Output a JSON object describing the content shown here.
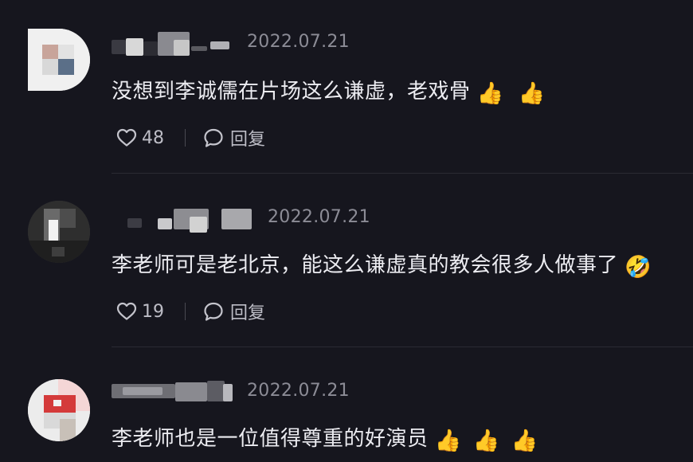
{
  "comments": [
    {
      "date": "2022.07.21",
      "text": "没想到李诚儒在片场这么谦虚，老戏骨",
      "emojis": [
        "👍",
        "👍"
      ],
      "likes": "48",
      "reply_label": "回复"
    },
    {
      "date": "2022.07.21",
      "text": "李老师可是老北京，能这么谦虚真的教会很多人做事了",
      "emojis": [
        "🤣"
      ],
      "likes": "19",
      "reply_label": "回复"
    },
    {
      "date": "2022.07.21",
      "text": "李老师也是一位值得尊重的好演员",
      "emojis": [
        "👍",
        "👍",
        "👍"
      ]
    }
  ],
  "icons": {
    "like": "heart-outline-icon",
    "reply": "speech-bubble-icon"
  },
  "colors": {
    "background": "#16161e",
    "text": "#ececf1",
    "meta": "#8c8c96"
  }
}
